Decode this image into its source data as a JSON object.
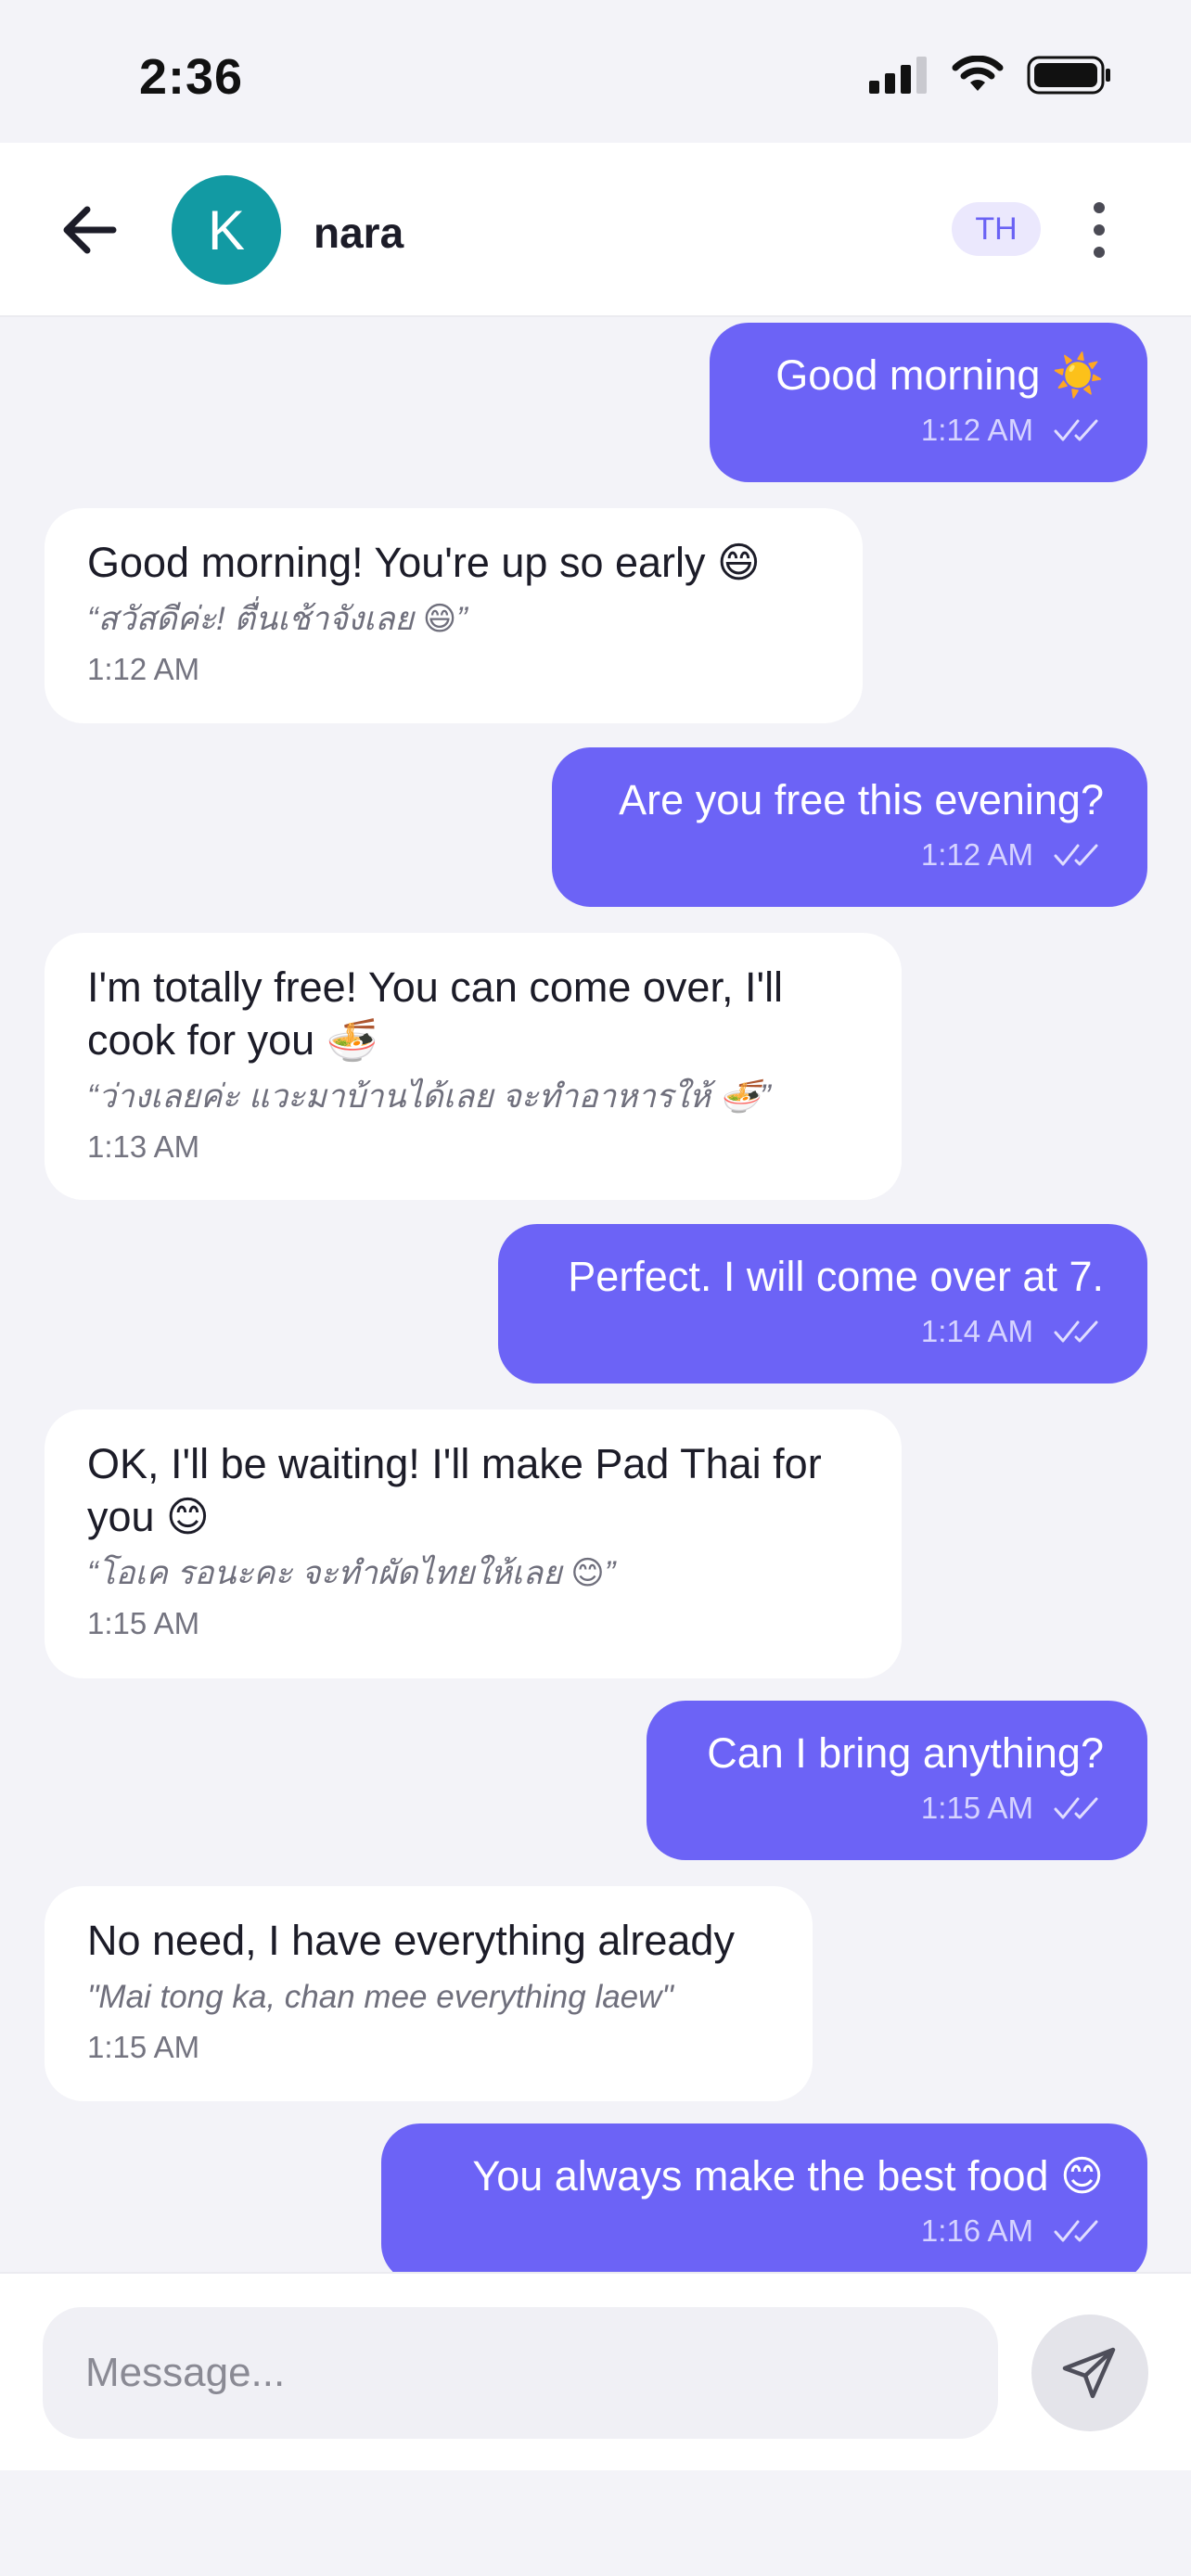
{
  "status_bar": {
    "time": "2:36"
  },
  "header": {
    "avatar_initial": "K",
    "contact_name": "nara",
    "language_badge": "TH"
  },
  "messages": [
    {
      "direction": "out",
      "text": "Good morning ☀️",
      "time": "1:12 AM"
    },
    {
      "direction": "in",
      "text": "Good morning! You're up so early 😄",
      "translation": "“สวัสดีค่ะ! ตื่นเช้าจังเลย 😄”",
      "time": "1:12 AM"
    },
    {
      "direction": "out",
      "text": "Are you free this evening?",
      "time": "1:12 AM"
    },
    {
      "direction": "in",
      "text": "I'm totally free! You can come over, I'll cook for you 🍜",
      "translation": "“ว่างเลยค่ะ แวะมาบ้านได้เลย จะทำอาหารให้ 🍜”",
      "time": "1:13 AM"
    },
    {
      "direction": "out",
      "text": "Perfect. I will come over at 7.",
      "time": "1:14 AM"
    },
    {
      "direction": "in",
      "text": "OK, I'll be waiting! I'll make Pad Thai for you 😊",
      "translation": "“โอเค รอนะคะ จะทำผัดไทยให้เลย 😊”",
      "time": "1:15 AM"
    },
    {
      "direction": "out",
      "text": "Can I bring anything?",
      "time": "1:15 AM"
    },
    {
      "direction": "in",
      "text": "No need, I have everything already",
      "translation": "\"Mai tong ka, chan mee everything laew\"",
      "time": "1:15 AM"
    },
    {
      "direction": "out",
      "text": "You always make the best food 😊",
      "time": "1:16 AM"
    }
  ],
  "composer": {
    "placeholder": "Message..."
  },
  "icons": {
    "back": "arrow-left-icon",
    "menu": "more-vertical-icon",
    "send": "send-icon",
    "read_receipt": "double-check-icon"
  },
  "colors": {
    "accent": "#6c63f6",
    "avatar": "#129aa3",
    "background": "#f3f3f8",
    "incoming_bubble": "#ffffff"
  }
}
